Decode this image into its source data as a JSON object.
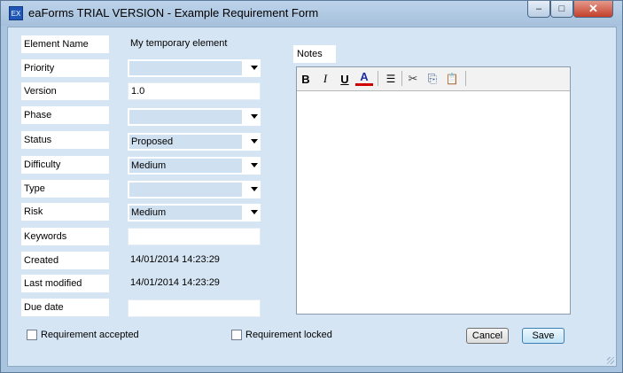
{
  "window": {
    "title": "eaForms TRIAL VERSION - Example Requirement Form",
    "icon_text": "EX",
    "controls": {
      "minimize": "–",
      "maximize": "□",
      "close": "✕"
    }
  },
  "fields": {
    "element_name": {
      "label": "Element Name",
      "value": "My temporary element"
    },
    "priority": {
      "label": "Priority",
      "value": ""
    },
    "version": {
      "label": "Version",
      "value": "1.0"
    },
    "phase": {
      "label": "Phase",
      "value": ""
    },
    "status": {
      "label": "Status",
      "value": "Proposed"
    },
    "difficulty": {
      "label": "Difficulty",
      "value": "Medium"
    },
    "type": {
      "label": "Type",
      "value": ""
    },
    "risk": {
      "label": "Risk",
      "value": "Medium"
    },
    "keywords": {
      "label": "Keywords",
      "value": ""
    },
    "created": {
      "label": "Created",
      "value": "14/01/2014 14:23:29"
    },
    "last_modified": {
      "label": "Last modified",
      "value": "14/01/2014 14:23:29"
    },
    "due_date": {
      "label": "Due date",
      "value": ""
    }
  },
  "notes": {
    "label": "Notes",
    "content": "",
    "toolbar": {
      "bold": "B",
      "italic": "I",
      "underline": "U",
      "font_color": "A",
      "font_color_hex": "#d00000",
      "bullets": "☰",
      "cut": "✂",
      "copy": "⎘",
      "paste": "📋"
    }
  },
  "checkboxes": {
    "requirement_accepted": {
      "label": "Requirement accepted",
      "checked": false
    },
    "requirement_locked": {
      "label": "Requirement locked",
      "checked": false
    }
  },
  "buttons": {
    "cancel": "Cancel",
    "save": "Save"
  }
}
